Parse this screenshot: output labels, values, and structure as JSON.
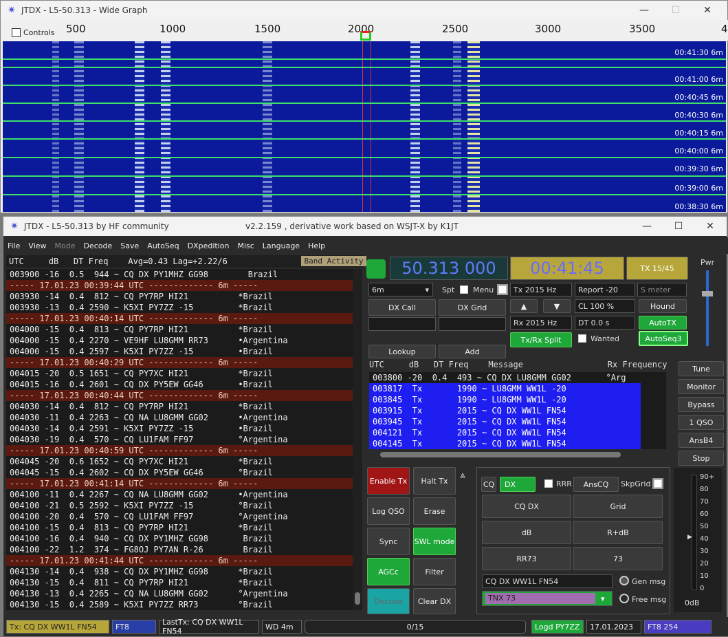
{
  "widegraph": {
    "title": "JTDX - L5-50.313 - Wide Graph",
    "controls_label": "Controls",
    "ticks": [
      "500",
      "1000",
      "1500",
      "2000",
      "2500",
      "3000",
      "3500",
      "4"
    ],
    "times": [
      "00:41:30  6m",
      "00:41:00  6m",
      "00:40:45  6m",
      "00:40:30  6m",
      "00:40:15  6m",
      "00:40:00  6m",
      "00:39:30  6m",
      "00:39:00  6m",
      "00:38:30  6m"
    ]
  },
  "main": {
    "title": "JTDX - L5-50.313   by HF community",
    "subtitle": "v2.2.159 , derivative work based on WSJT-X by K1JT",
    "menu": [
      "File",
      "View",
      "Mode",
      "Decode",
      "Save",
      "AutoSeq",
      "DXpedition",
      "Misc",
      "Language",
      "Help"
    ],
    "band_header": "UTC     dB   DT Freq    Avg=0.43 Lag=+2.22/6",
    "band_activity": "Band Activity",
    "band_rows": [
      {
        "t": "003900 -16  0.5  944 ~ CQ DX PY1MHZ GG98        Brazil",
        "s": 0
      },
      {
        "t": "----- 17.01.23 00:39:44 UTC ------------- 6m -----",
        "s": 1
      },
      {
        "t": "003930 -14  0.4  812 ~ CQ PY7RP HI21          *Brazil",
        "s": 0
      },
      {
        "t": "003930 -13  0.4 2590 ~ K5XI PY7ZZ -15         *Brazil",
        "s": 0
      },
      {
        "t": "----- 17.01.23 00:40:14 UTC ------------- 6m -----",
        "s": 1
      },
      {
        "t": "004000 -15  0.4  813 ~ CQ PY7RP HI21          *Brazil",
        "s": 0
      },
      {
        "t": "004000 -15  0.4 2270 ~ VE9HF LU8GMM RR73      •Argentina",
        "s": 0
      },
      {
        "t": "004000 -15  0.4 2597 ~ K5XI PY7ZZ -15         •Brazil",
        "s": 0
      },
      {
        "t": "----- 17.01.23 00:40:29 UTC ------------- 6m -----",
        "s": 1
      },
      {
        "t": "004015 -20  0.5 1651 ~ CQ PY7XC HI21          *Brazil",
        "s": 0
      },
      {
        "t": "004015 -16  0.4 2601 ~ CQ DX PY5EW GG46       •Brazil",
        "s": 0
      },
      {
        "t": "----- 17.01.23 00:40:44 UTC ------------- 6m -----",
        "s": 1
      },
      {
        "t": "004030 -14  0.4  812 ~ CQ PY7RP HI21          *Brazil",
        "s": 0
      },
      {
        "t": "004030 -11  0.4 2263 ~ CQ NA LU8GMM GG02      •Argentina",
        "s": 0
      },
      {
        "t": "004030 -14  0.4 2591 ~ K5XI PY7ZZ -15         •Brazil",
        "s": 0
      },
      {
        "t": "004030 -19  0.4  570 ~ CQ LU1FAM FF97         °Argentina",
        "s": 0
      },
      {
        "t": "----- 17.01.23 00:40:59 UTC ------------- 6m -----",
        "s": 1
      },
      {
        "t": "004045 -20  0.6 1652 ~ CQ PY7XC HI21          *Brazil",
        "s": 0
      },
      {
        "t": "004045 -15  0.4 2602 ~ CQ DX PY5EW GG46       °Brazil",
        "s": 0
      },
      {
        "t": "----- 17.01.23 00:41:14 UTC ------------- 6m -----",
        "s": 1
      },
      {
        "t": "004100 -11  0.4 2267 ~ CQ NA LU8GMM GG02      •Argentina",
        "s": 0
      },
      {
        "t": "004100 -21  0.5 2592 ~ K5XI PY7ZZ -15         °Brazil",
        "s": 0
      },
      {
        "t": "004100 -20  0.4  570 ~ CQ LU1FAM FF97         °Argentina",
        "s": 0
      },
      {
        "t": "004100 -15  0.4  813 ~ CQ PY7RP HI21          *Brazil",
        "s": 0
      },
      {
        "t": "004100 -16  0.4  940 ~ CQ DX PY1MHZ GG98       Brazil",
        "s": 0
      },
      {
        "t": "004100 -22  1.2  374 ~ FG8OJ PY7AN R-26        Brazil",
        "s": 0
      },
      {
        "t": "----- 17.01.23 00:41:44 UTC ------------- 6m -----",
        "s": 1
      },
      {
        "t": "004130 -14  0.4  938 ~ CQ DX PY1MHZ GG98      *Brazil",
        "s": 0
      },
      {
        "t": "004130 -15  0.4  811 ~ CQ PY7RP HI21          *Brazil",
        "s": 0
      },
      {
        "t": "004130 -13  0.4 2265 ~ CQ NA LU8GMM GG02      °Argentina",
        "s": 0
      },
      {
        "t": "004130 -15  0.4 2589 ~ K5XI PY7ZZ RR73        °Brazil",
        "s": 0
      }
    ],
    "freq": "50.313 000",
    "clock": "00:41:45",
    "tx1545": "TX 15/45",
    "pwr": "Pwr",
    "band": "6m",
    "spt": "Spt",
    "menu_lbl": "Menu",
    "tx_hz": "Tx  2015  Hz",
    "rx_hz": "Rx  2015  Hz",
    "report": "Report -20",
    "smeter": "S meter",
    "cl": "CL  100 %",
    "dt": "DT 0.0 s",
    "hound": "Hound",
    "autotx": "AutoTX",
    "autoseq3": "AutoSeq3",
    "wanted": "Wanted",
    "dxcall": "DX Call",
    "dxgrid": "DX Grid",
    "lookup": "Lookup",
    "add": "Add",
    "txrxsplit": "Tx/Rx Split",
    "rx_header": "UTC     dB   DT Freq    Message                 Rx Frequency",
    "rx_rows": [
      {
        "t": "003800 -20  0.4  493 ~ CQ DX LU8GMM GG02       °Arg",
        "tx": 0
      },
      {
        "t": "003817  Tx       1990 ~ LU8GMM WW1L -20",
        "tx": 1
      },
      {
        "t": "003845  Tx       1990 ~ LU8GMM WW1L -20",
        "tx": 1
      },
      {
        "t": "003915  Tx       2015 ~ CQ DX WW1L FN54",
        "tx": 1
      },
      {
        "t": "003945  Tx       2015 ~ CQ DX WW1L FN54",
        "tx": 1
      },
      {
        "t": "004121  Tx       2015 ~ CQ DX WW1L FN54",
        "tx": 1
      },
      {
        "t": "004145  Tx       2015 ~ CQ DX WW1L FN54",
        "tx": 1
      }
    ],
    "right_btns": [
      "Tune",
      "Monitor",
      "Bypass",
      "1 QSO",
      "AnsB4",
      "Stop"
    ],
    "enable_tx": "Enable Tx",
    "halt_tx": "Halt Tx",
    "log_qso": "Log QSO",
    "erase": "Erase",
    "sync": "Sync",
    "swl": "SWL mode",
    "agcc": "AGCc",
    "filter": "Filter",
    "decode": "Decode",
    "clear_dx": "Clear DX",
    "cq": "CQ",
    "dx": "DX",
    "rrr": "RRR",
    "anscq": "AnsCQ",
    "skpgrid": "SkpGrid",
    "macros": [
      "CQ DX",
      "Grid",
      "dB",
      "R+dB",
      "RR73",
      "73"
    ],
    "gen_msg_text": "CQ DX WW1L FN54",
    "gen_msg": "Gen msg",
    "tnx": "TNX 73",
    "free_msg": "Free msg",
    "meter_scale": [
      "90+",
      "80",
      "70",
      "60",
      "50",
      "40",
      "30",
      "20",
      "10",
      "0"
    ],
    "meter_db": "0dB",
    "status": {
      "tx": "Tx: CQ DX WW1L FN54",
      "mode": "FT8",
      "lasttx": "LastTx: CQ DX WW1L FN54",
      "wd": "WD 4m",
      "prog": "0/15",
      "logd": "Logd PY7ZZ",
      "date": "17.01.2023",
      "ft8n": "FT8  254"
    }
  }
}
